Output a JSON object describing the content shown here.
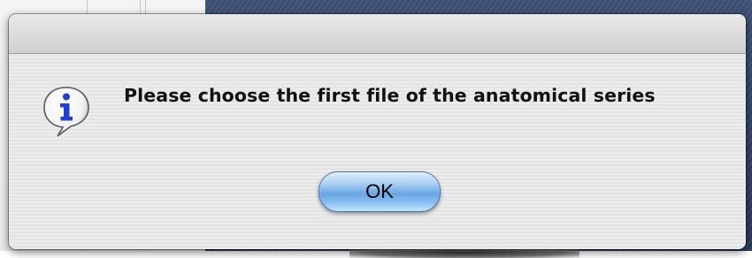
{
  "dialog": {
    "message": "Please choose the first file of the anatomical series",
    "icon": "info-speech-bubble-icon",
    "ok_label": "OK"
  },
  "colors": {
    "accent_button": "#6aa6e6",
    "icon_blue": "#1e3fd6"
  }
}
